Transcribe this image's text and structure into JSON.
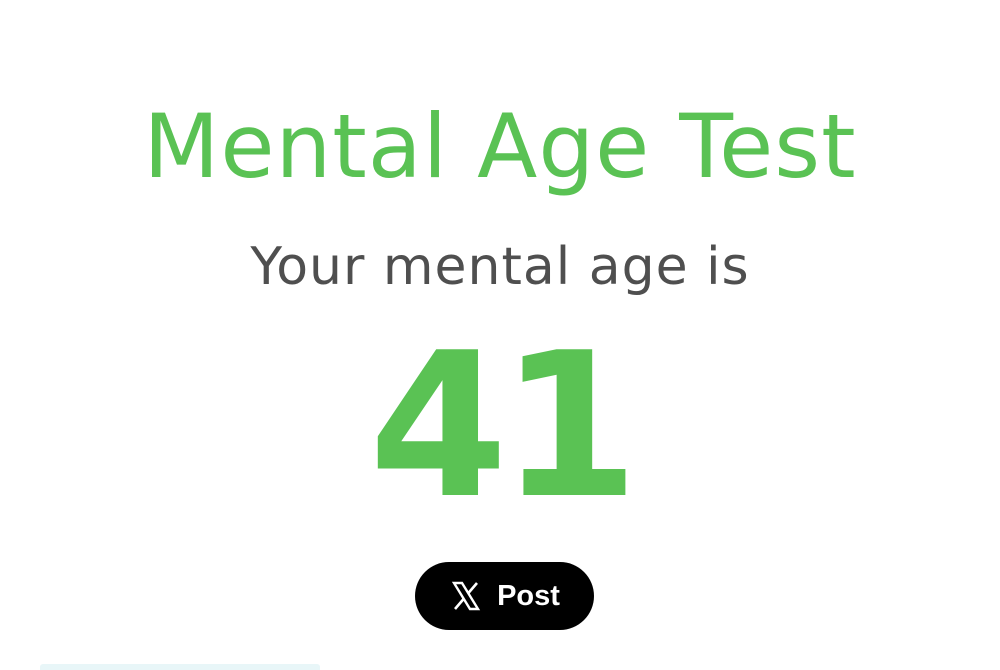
{
  "header": {
    "title": "Mental Age Test"
  },
  "result": {
    "subtitle": "Your mental age is",
    "age": "41"
  },
  "share": {
    "post_label": "Post",
    "icon": "x-logo-icon"
  },
  "colors": {
    "accent": "#5ac254",
    "text": "#4f4f4f",
    "button_bg": "#000000",
    "button_text": "#ffffff"
  }
}
